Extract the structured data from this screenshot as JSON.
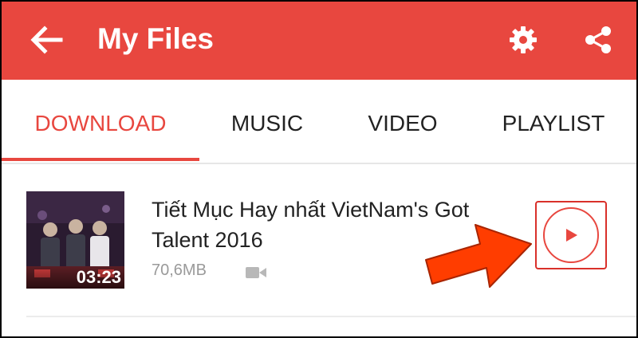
{
  "appbar": {
    "title": "My Files",
    "icons": [
      "back-arrow-icon",
      "settings-gear-icon",
      "share-icon"
    ],
    "color": "#e8473f"
  },
  "tabs": [
    {
      "label": "DOWNLOAD",
      "active": true
    },
    {
      "label": "MUSIC",
      "active": false
    },
    {
      "label": "VIDEO",
      "active": false
    },
    {
      "label": "PLAYLIST",
      "active": false
    }
  ],
  "downloads": [
    {
      "title": "Tiết Mục Hay nhất VietNam's Got Talent 2016",
      "size": "70,6MB",
      "duration": "03:23",
      "type_icon": "video-camera-icon",
      "action_icon": "play-icon"
    }
  ],
  "annotation": {
    "arrow_color": "#ff3d00",
    "highlight_color": "#d9302a"
  }
}
